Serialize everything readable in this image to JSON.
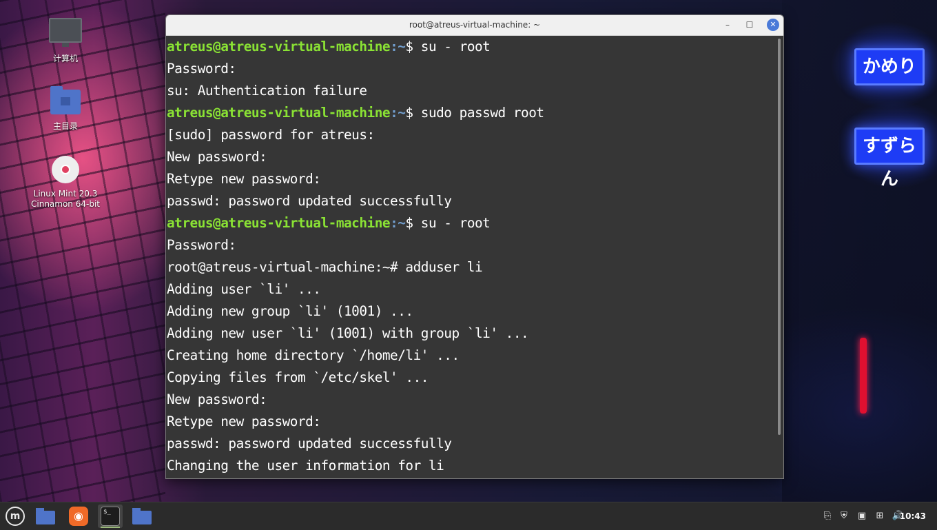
{
  "desktop": {
    "icons": [
      {
        "label": "计算机",
        "icon": "computer-icon"
      },
      {
        "label": "主目录",
        "icon": "home-folder-icon"
      },
      {
        "label": "Linux Mint 20.3 Cinnamon 64-bit",
        "icon": "disc-icon"
      }
    ],
    "signs": [
      "かめり",
      "すずらん"
    ]
  },
  "window": {
    "title": "root@atreus-virtual-machine: ~",
    "controls": {
      "minimize": "–",
      "maximize": "☐",
      "close": "✕"
    }
  },
  "terminal": {
    "prompt_user": "atreus@atreus-virtual-machine",
    "prompt_path": ":~",
    "lines": [
      {
        "prompt": true,
        "cmd": "$ su - root"
      },
      {
        "text": "Password:"
      },
      {
        "text": "su: Authentication failure"
      },
      {
        "prompt": true,
        "cmd": "$ sudo passwd root"
      },
      {
        "text": "[sudo] password for atreus:"
      },
      {
        "text": "New password:"
      },
      {
        "text": "Retype new password:"
      },
      {
        "text": "passwd: password updated successfully"
      },
      {
        "prompt": true,
        "cmd": "$ su - root"
      },
      {
        "text": "Password:"
      },
      {
        "text": "root@atreus-virtual-machine:~# adduser li"
      },
      {
        "text": "Adding user `li' ..."
      },
      {
        "text": "Adding new group `li' (1001) ..."
      },
      {
        "text": "Adding new user `li' (1001) with group `li' ..."
      },
      {
        "text": "Creating home directory `/home/li' ..."
      },
      {
        "text": "Copying files from `/etc/skel' ..."
      },
      {
        "text": "New password:"
      },
      {
        "text": "Retype new password:"
      },
      {
        "text": "passwd: password updated successfully"
      },
      {
        "text": "Changing the user information for li"
      }
    ]
  },
  "taskbar": {
    "menu_icon": "mint-menu-icon",
    "apps": [
      "files-icon",
      "firefox-icon",
      "terminal-icon",
      "files-window-icon"
    ],
    "terminal_glyph": "$_",
    "tray": [
      "clipboard-icon",
      "shield-icon",
      "update-icon",
      "network-icon",
      "volume-icon"
    ],
    "clock": "10:43"
  },
  "colors": {
    "prompt_user": "#8ae234",
    "prompt_path": "#729fcf",
    "terminal_bg": "#363636"
  }
}
